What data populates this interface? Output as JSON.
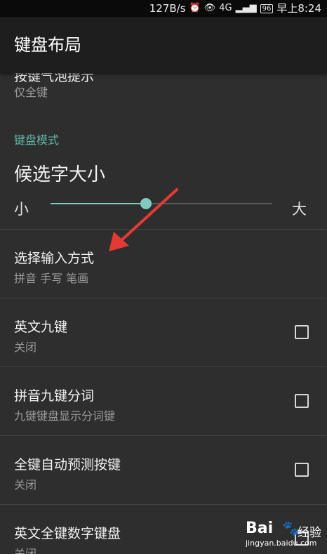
{
  "status_bar": {
    "speed": "127B/s",
    "network": "4G",
    "battery": "96",
    "time": "早上8:24"
  },
  "app_bar": {
    "title": "键盘布局"
  },
  "items": {
    "key_popup": {
      "title": "按键气泡提示",
      "subtitle": "仅全键"
    },
    "section_header": "键盘模式",
    "candidate_size": {
      "title": "候选字大小",
      "min_label": "小",
      "max_label": "大",
      "value_fraction": 0.43
    },
    "input_method": {
      "title": "选择输入方式",
      "subtitle": "拼音 手写 笔画"
    },
    "english_nine": {
      "title": "英文九键",
      "subtitle": "关闭",
      "checked": false
    },
    "pinyin_nine_seg": {
      "title": "拼音九键分词",
      "subtitle": "九键键盘显示分词键",
      "checked": false
    },
    "full_predict": {
      "title": "全键自动预测按键",
      "subtitle": "关闭",
      "checked": false
    },
    "english_full_num": {
      "title": "英文全键数字键盘",
      "subtitle": "关闭",
      "checked": false
    }
  },
  "annotation": {
    "arrow_color": "#e53935"
  },
  "watermark": {
    "brand": "Bai",
    "text": "经验",
    "url": "jingyan.baidu.com"
  },
  "colors": {
    "accent": "#5fb8a8",
    "background": "#2e2e2e",
    "app_bar": "#1e1e1e"
  }
}
